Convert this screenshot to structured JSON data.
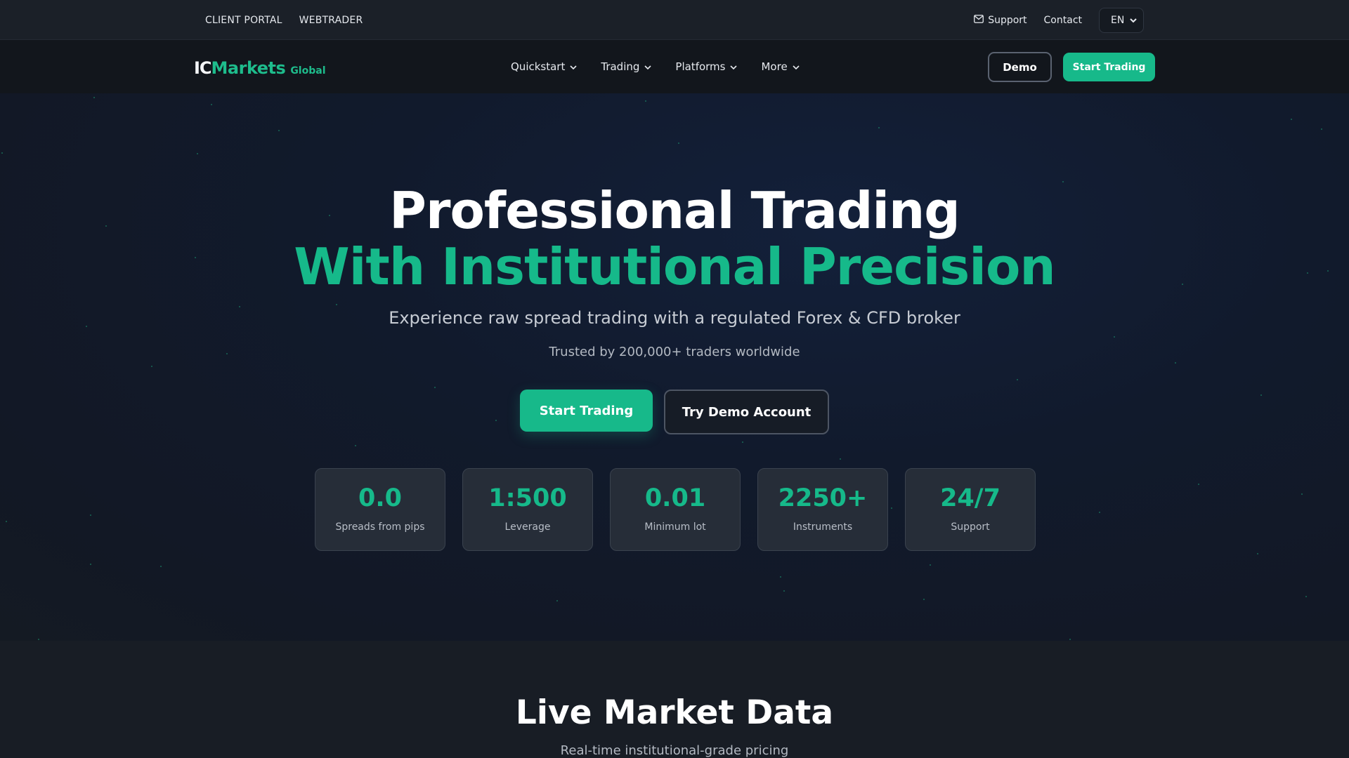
{
  "topbar": {
    "links": [
      "CLIENT PORTAL",
      "WEBTRADER"
    ],
    "support": "Support",
    "contact": "Contact",
    "language": "EN"
  },
  "nav": {
    "logo_ic": "IC",
    "logo_markets": "Markets",
    "logo_global": "Global",
    "menu": [
      "Quickstart",
      "Trading",
      "Platforms",
      "More"
    ],
    "demo_button": "Demo",
    "start_button": "Start Trading"
  },
  "hero": {
    "title_line1": "Professional Trading",
    "title_line2": "With Institutional Precision",
    "subtitle": "Experience raw spread trading with a regulated Forex & CFD broker",
    "trust": "Trusted by 200,000+ traders worldwide",
    "cta_primary": "Start Trading",
    "cta_secondary": "Try Demo Account",
    "stats": [
      {
        "value": "0.0",
        "label": "Spreads from pips"
      },
      {
        "value": "1:500",
        "label": "Leverage"
      },
      {
        "value": "0.01",
        "label": "Minimum lot"
      },
      {
        "value": "2250+",
        "label": "Instruments"
      },
      {
        "value": "24/7",
        "label": "Support"
      }
    ]
  },
  "live": {
    "title": "Live Market Data",
    "subtitle": "Real-time institutional-grade pricing"
  },
  "colors": {
    "accent": "#17b98a",
    "background": "#181d25",
    "nav_background": "#12161c"
  }
}
